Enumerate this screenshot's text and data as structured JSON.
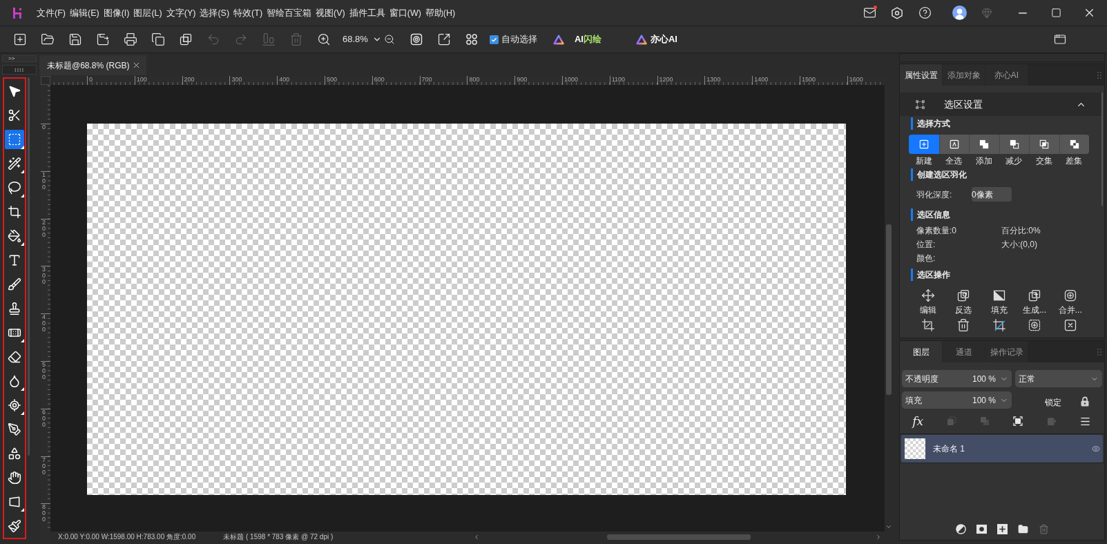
{
  "menu": [
    "文件(F)",
    "编辑(E)",
    "图像(I)",
    "图层(L)",
    "文字(Y)",
    "选择(S)",
    "特效(T)",
    "智绘百宝箱",
    "视图(V)",
    "插件工具",
    "窗口(W)",
    "帮助(H)"
  ],
  "header": {
    "mail_unread": true
  },
  "toolbar": {
    "buttons": [
      {
        "disabled": false
      },
      {
        "disabled": false
      },
      {
        "disabled": false
      },
      {
        "disabled": false
      },
      {
        "disabled": false
      },
      {
        "disabled": false
      },
      {
        "disabled": false
      },
      {
        "disabled": true
      },
      {
        "disabled": true
      },
      {
        "disabled": true
      },
      {
        "disabled": true
      },
      {
        "disabled": false
      }
    ],
    "zoom": "68.8%",
    "auto_select": {
      "label": "自动选择",
      "checked": true
    },
    "ai_buttons": [
      {
        "label": "AI",
        "accent": "闪绘"
      },
      {
        "label": "亦心AI"
      }
    ]
  },
  "left_panel": {
    "expand": ">>",
    "tools": [
      {
        "selected": false,
        "grouped": false
      },
      {
        "selected": false,
        "grouped": false
      },
      {
        "selected": true,
        "grouped": true
      },
      {
        "selected": false,
        "grouped": true
      },
      {
        "selected": false,
        "grouped": true
      },
      {
        "selected": false,
        "grouped": false
      },
      {
        "selected": false,
        "grouped": true
      },
      {
        "selected": false,
        "grouped": false
      },
      {
        "selected": false,
        "grouped": false
      },
      {
        "selected": false,
        "grouped": false
      },
      {
        "selected": false,
        "grouped": true
      },
      {
        "selected": false,
        "grouped": false
      },
      {
        "selected": false,
        "grouped": true
      },
      {
        "selected": false,
        "grouped": true
      },
      {
        "selected": false,
        "grouped": false
      },
      {
        "selected": false,
        "grouped": false
      },
      {
        "selected": false,
        "grouped": false
      },
      {
        "selected": false,
        "grouped": true
      },
      {
        "selected": false,
        "grouped": false
      }
    ]
  },
  "document_tabs": [
    {
      "title": "未标题@68.8% (RGB)",
      "selected": true
    }
  ],
  "rulers": {
    "horizontal": [
      "0",
      "100",
      "200",
      "300",
      "400",
      "500",
      "600",
      "700",
      "800",
      "900",
      "1000",
      "1100",
      "1200",
      "1300",
      "1400",
      "1500",
      "1600"
    ],
    "vertical": [
      "0",
      "100",
      "200",
      "300",
      "400",
      "500",
      "600",
      "700",
      "800"
    ]
  },
  "status_bar": {
    "cursor": "X:0.00 Y:0.00 W:1598.00 H:783.00 角度:0.00",
    "document": "未标题 ( 1598 * 783 像素 @ 72 dpi )"
  },
  "properties_panel": {
    "tabs": [
      {
        "label": "属性设置",
        "selected": true
      },
      {
        "label": "添加对象",
        "selected": false
      },
      {
        "label": "亦心AI",
        "selected": false
      }
    ],
    "section": {
      "title": "选区设置",
      "expanded": true
    },
    "mode_heading": "选择方式",
    "modes": [
      {
        "label": "新建",
        "selected": true
      },
      {
        "label": "全选",
        "selected": false
      },
      {
        "label": "添加",
        "selected": false
      },
      {
        "label": "减少",
        "selected": false
      },
      {
        "label": "交集",
        "selected": false
      },
      {
        "label": "差集",
        "selected": false
      }
    ],
    "feather_heading": "创建选区羽化",
    "feather": {
      "label": "羽化深度:",
      "value": "0像素"
    },
    "info_heading": "选区信息",
    "info": [
      "像素数量:0",
      "百分比:0%",
      "位置:",
      "大小:(0,0)",
      "颜色:"
    ],
    "ops_heading": "选区操作",
    "operations": [
      "编辑",
      "反选",
      "填充",
      "生成...",
      "合并..."
    ]
  },
  "layers_panel": {
    "tabs": [
      {
        "label": "图层",
        "selected": true
      },
      {
        "label": "通道",
        "selected": false
      },
      {
        "label": "操作记录",
        "selected": false
      }
    ],
    "opacity": {
      "label": "不透明度",
      "value": "100 %"
    },
    "blend_mode": "正常",
    "fill": {
      "label": "填充",
      "value": "100 %"
    },
    "lock_label": "锁定",
    "fx": "fx",
    "actions": [
      {
        "disabled": true
      },
      {
        "disabled": true
      },
      {
        "disabled": false
      },
      {
        "disabled": true
      }
    ],
    "layers": [
      {
        "name": "未命名 1",
        "selected": true,
        "visible": true
      }
    ],
    "footer_buttons": [
      {
        "disabled": false
      },
      {
        "disabled": false
      },
      {
        "disabled": false
      },
      {
        "disabled": false
      },
      {
        "disabled": true
      }
    ]
  }
}
